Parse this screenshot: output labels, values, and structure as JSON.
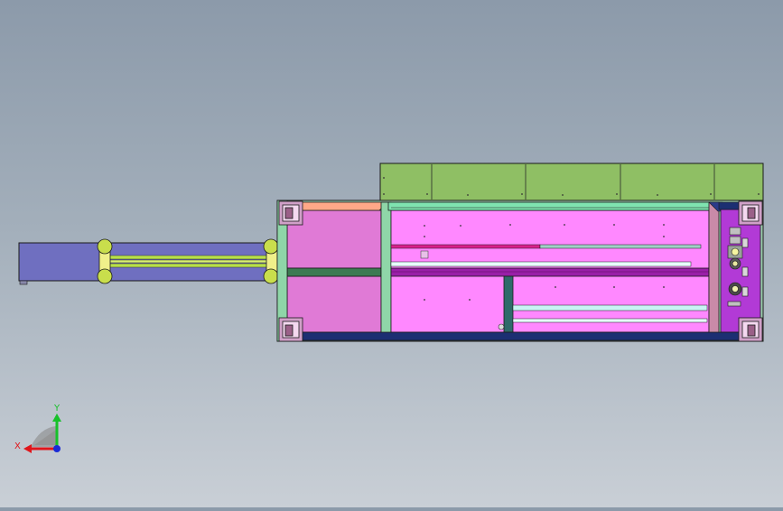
{
  "triad": {
    "x_label": "X",
    "y_label": "Y",
    "x_color": "#e0161b",
    "y_color": "#17c12a",
    "z_color": "#1a2bd6"
  },
  "colors": {
    "background_top": "#8c9aaa",
    "background_bottom": "#c9cfd6",
    "frame_outline": "#1a1a1a",
    "top_panel": "#8fbf64",
    "main_body": "#ff88ff",
    "left_section": "#e07ad6",
    "frame_green": "#8fd6a8",
    "bottom_rail": "#1c2f72",
    "arm_body": "#6f6fc0",
    "arm_rod": "#b8e04a",
    "arm_collar": "#c9de4c",
    "control_panel": "#b23ad6"
  }
}
